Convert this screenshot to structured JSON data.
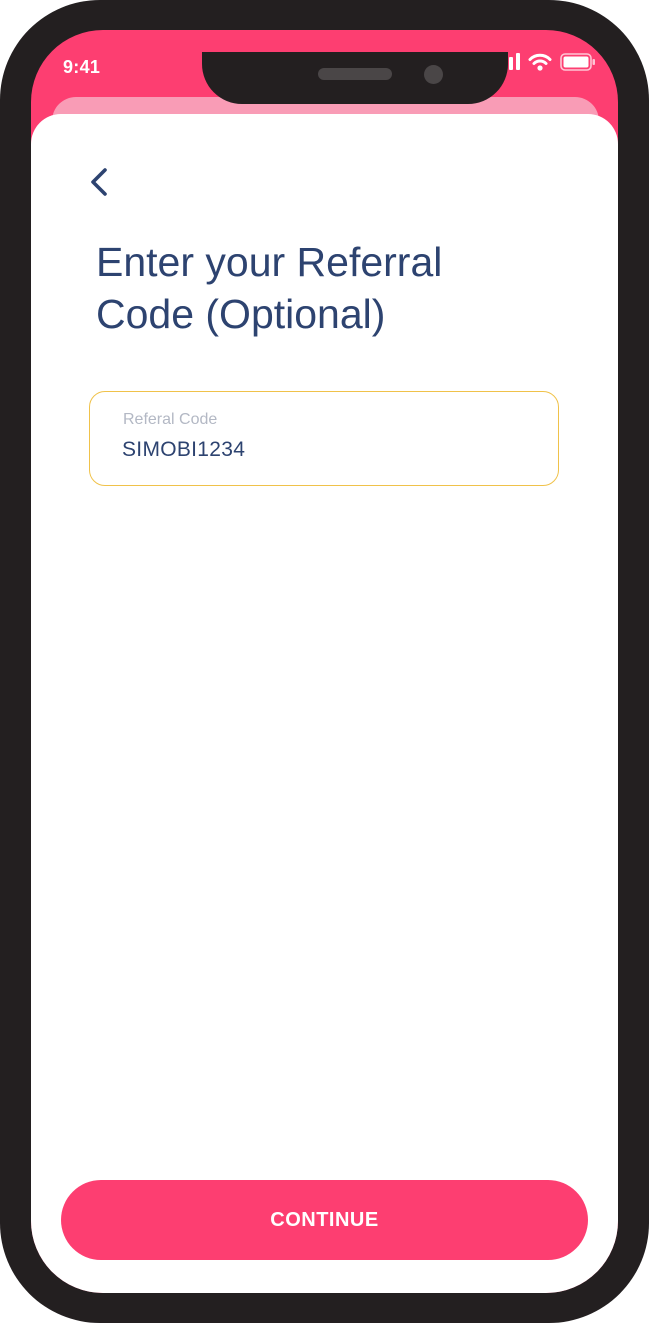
{
  "status_bar": {
    "time": "9:41",
    "icons": [
      "cellular-signal-icon",
      "wifi-icon",
      "battery-icon"
    ]
  },
  "header": {
    "back_icon": "chevron-left-icon"
  },
  "page": {
    "title_line1": "Enter your Referral",
    "title_line2": "Code (Optional)"
  },
  "referral_field": {
    "label": "Referal Code",
    "value": "SIMOBI1234"
  },
  "footer": {
    "continue_label": "CONTINUE"
  },
  "colors": {
    "brand_pink": "#fd3e71",
    "light_pink": "#f99cb6",
    "title_navy": "#2d4370",
    "field_border_yellow": "#f0c24a",
    "label_gray": "#b3b8c4",
    "phone_frame": "#231f20"
  }
}
